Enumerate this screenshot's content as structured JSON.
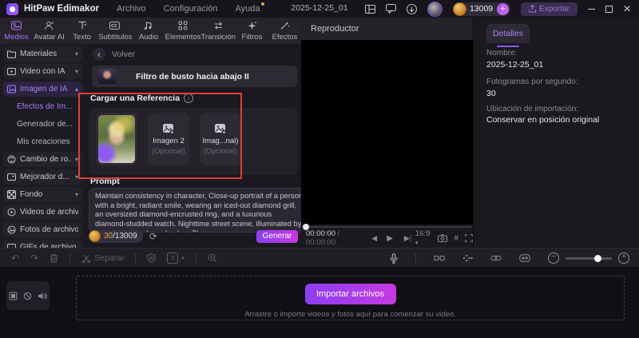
{
  "titlebar": {
    "app_name": "HitPaw Edimakor",
    "menus": [
      {
        "label": "Archivo"
      },
      {
        "label": "Configuración"
      },
      {
        "label": "Ayuda"
      }
    ],
    "project_title": "2025-12-25_01",
    "credits": "13009",
    "plus_label": "+",
    "export_label": "Exportar"
  },
  "tabs": [
    {
      "label": "Medios"
    },
    {
      "label": "Avatar AI"
    },
    {
      "label": "Texto"
    },
    {
      "label": "Subtítulos"
    },
    {
      "label": "Audio"
    },
    {
      "label": "Elementos"
    },
    {
      "label": "Transición"
    },
    {
      "label": "Filtros"
    },
    {
      "label": "Efectos"
    }
  ],
  "sidebar": {
    "items": [
      {
        "label": "Materiales"
      },
      {
        "label": "Video con IA"
      },
      {
        "label": "Imagen de IA"
      },
      {
        "label": "Efectos de Im..."
      },
      {
        "label": "Generador de..."
      },
      {
        "label": "Mis creaciones"
      },
      {
        "label": "Cambio de ro..."
      },
      {
        "label": "Mejorador d..."
      },
      {
        "label": "Fondo"
      },
      {
        "label": "Videos de archivo"
      },
      {
        "label": "Fotos de archivo"
      },
      {
        "label": "GIFs de archivo"
      }
    ]
  },
  "main": {
    "back_label": "Volver",
    "filter_card_title": "Filtro de busto hacia abajo II",
    "reference_section_title": "Cargar una Referencia",
    "reference_cards": [
      {
        "label": "Imagen 2",
        "sublabel": "(Opcional)"
      },
      {
        "label": "Imag...nal)",
        "sublabel": "(Opcional)"
      }
    ],
    "prompt_label": "Prompt",
    "prompt_text": "Maintain consistency in character,  Close-up portrait of a person with a bright, radiant smile, wearing an iced-out diamond grill, an oversized diamond-encrusted ring, and a luxurious diamond-studded watch. Nighttime street scene, illuminated by a neon blue and purple glow. The",
    "tokens_used": "30",
    "tokens_total": "/13009",
    "generate_label": "Generar"
  },
  "player": {
    "title": "Reproductor",
    "time_current": "00:00:00",
    "time_separator": " / ",
    "time_total": "00:00:00",
    "aspect_ratio": "16:9"
  },
  "details": {
    "tab_label": "Detalles",
    "name_label": "Nombre:",
    "name_value": "2025-12-25_01",
    "fps_label": "Fotogramas por segundo:",
    "fps_value": "30",
    "location_label": "Ubicación de importación:",
    "location_value": "Conservar en posición original"
  },
  "toolbar": {
    "separate_label": "Separar"
  },
  "timeline": {
    "import_button_label": "Importar archivos",
    "drop_hint": "Arrastre o importe videos y fotos aquí para comenzar su video."
  },
  "colors": {
    "accent_purple": "#a873f5",
    "highlight_red": "#d94436",
    "coin_gold": "#dd9f3f",
    "button_gradient_start": "#8a3ff0",
    "button_gradient_end": "#c63ae0"
  }
}
